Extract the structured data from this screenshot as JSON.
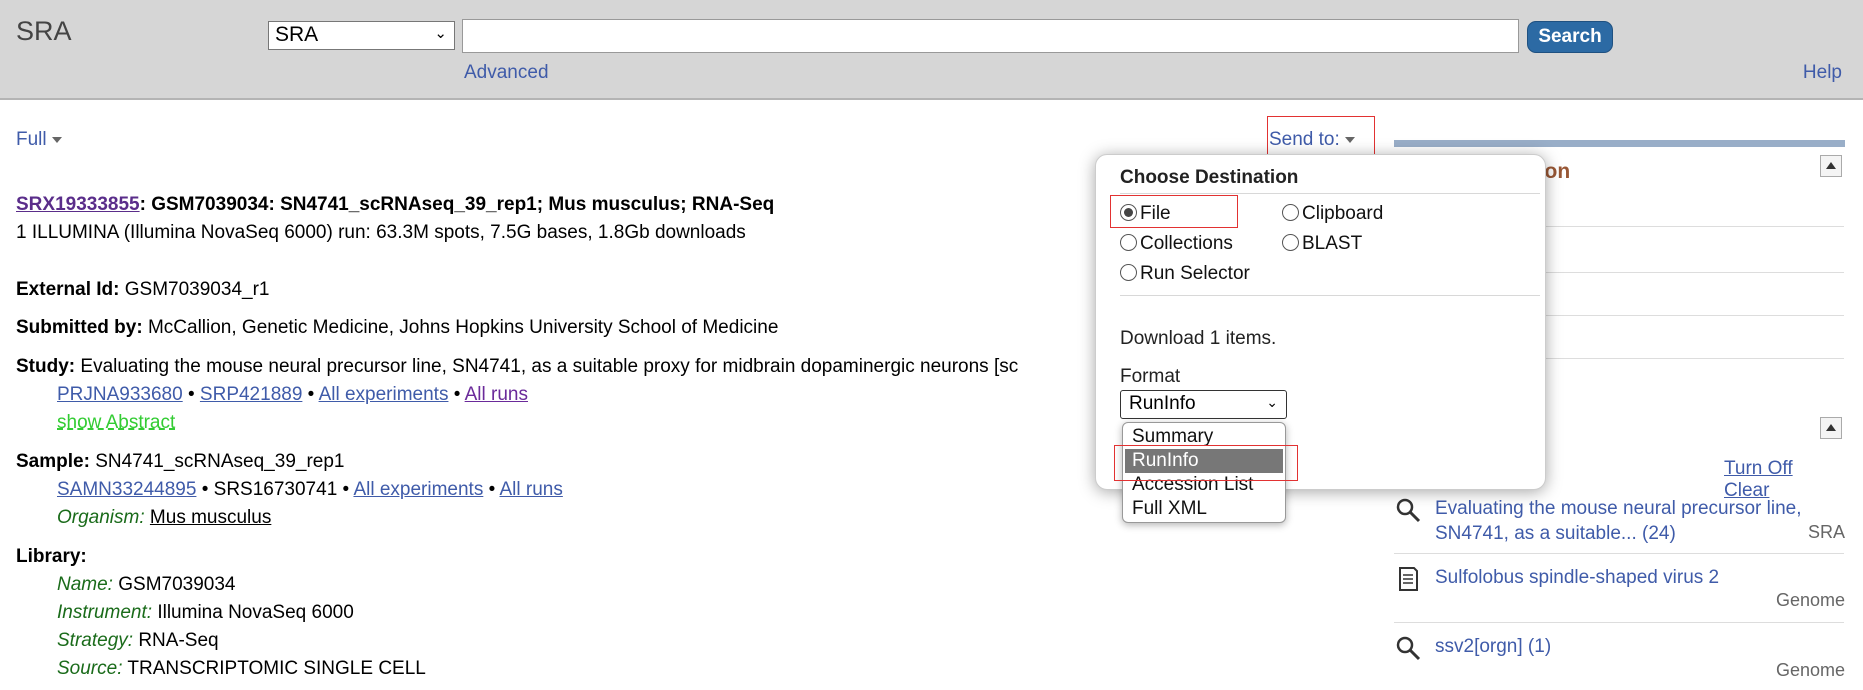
{
  "header": {
    "db_name": "SRA",
    "db_select": "SRA",
    "search_value": "",
    "search_button": "Search",
    "advanced": "Advanced",
    "help": "Help"
  },
  "display": {
    "full": "Full",
    "send_to": "Send to:"
  },
  "record": {
    "accession": "SRX19333855",
    "title_rest": ": GSM7039034: SN4741_scRNAseq_39_rep1; Mus musculus; RNA-Seq",
    "run_summary": "1 ILLUMINA (Illumina NovaSeq 6000) run: 63.3M spots, 7.5G bases, 1.8Gb downloads",
    "external_id_label": "External Id:",
    "external_id": "GSM7039034_r1",
    "submitted_label": "Submitted by:",
    "submitted": "McCallion, Genetic Medicine, Johns Hopkins University School of Medicine",
    "study_label": "Study:",
    "study": "Evaluating the mouse neural precursor line, SN4741, as a suitable proxy for midbrain dopaminergic neurons [sc",
    "study_links": [
      "PRJNA933680",
      "SRP421889",
      "All experiments",
      "All runs"
    ],
    "show_abstract": "show Abstract",
    "sample_label": "Sample:",
    "sample": "SN4741_scRNAseq_39_rep1",
    "sample_links": [
      "SAMN33244895",
      "SRS16730741",
      "All experiments",
      "All runs"
    ],
    "organism_label": "Organism:",
    "organism": "Mus musculus",
    "library_label": "Library:",
    "name_label": "Name:",
    "name": "GSM7039034",
    "instrument_label": "Instrument:",
    "instrument": "Illumina NovaSeq 6000",
    "strategy_label": "Strategy:",
    "strategy": "RNA-Seq",
    "source_label": "Source:",
    "source": "TRANSCRIPTOMIC SINGLE CELL",
    "bullet": "•"
  },
  "right_column": {
    "title_visible": "ation",
    "turn_off": "Turn Off",
    "clear": "Clear",
    "history": [
      {
        "text": "Evaluating the mouse neural precursor line, SN4741, as a suitable... (24)",
        "db": "SRA",
        "icon": "magnifier-icon"
      },
      {
        "text": "Sulfolobus spindle-shaped virus 2",
        "db": "Genome",
        "icon": "document-icon"
      },
      {
        "text": "ssv2[orgn] (1)",
        "db": "Genome",
        "icon": "magnifier-icon"
      }
    ]
  },
  "popup": {
    "title": "Choose Destination",
    "options": [
      "File",
      "Clipboard",
      "Collections",
      "BLAST",
      "Run Selector"
    ],
    "selected": "File",
    "download_text": "Download 1 items.",
    "format_label": "Format",
    "format_value": "RunInfo",
    "format_options": [
      "Summary",
      "RunInfo",
      "Accession List",
      "Full XML"
    ]
  },
  "colors": {
    "accent": "#2c6aa4",
    "link": "#3f5ba9",
    "highlight_box": "#e23232"
  }
}
